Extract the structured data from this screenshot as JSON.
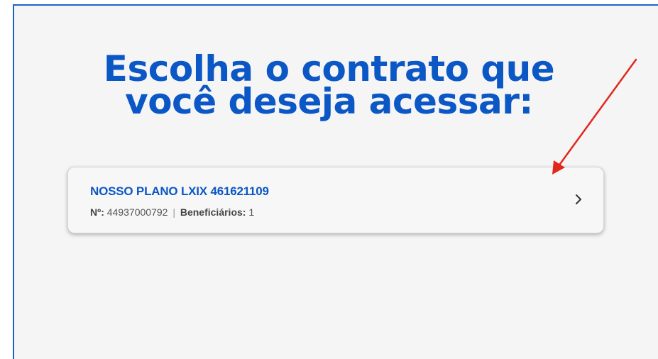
{
  "page": {
    "heading_line1": "Escolha o contrato que",
    "heading_line2": "você deseja acessar:"
  },
  "contracts": [
    {
      "name": "NOSSO PLANO LXIX 461621109",
      "number_label": "Nº:",
      "number_value": "44937000792",
      "separator": "|",
      "beneficiaries_label": "Beneficiários:",
      "beneficiaries_value": "1",
      "action_icon": "chevron-right-icon"
    }
  ],
  "annotation": {
    "arrow_color": "#e3261c",
    "arrow_icon": "red-arrow-annotation"
  },
  "colors": {
    "accent": "#0b57c5",
    "border": "#1e63c6",
    "background": "#f5f5f5"
  }
}
